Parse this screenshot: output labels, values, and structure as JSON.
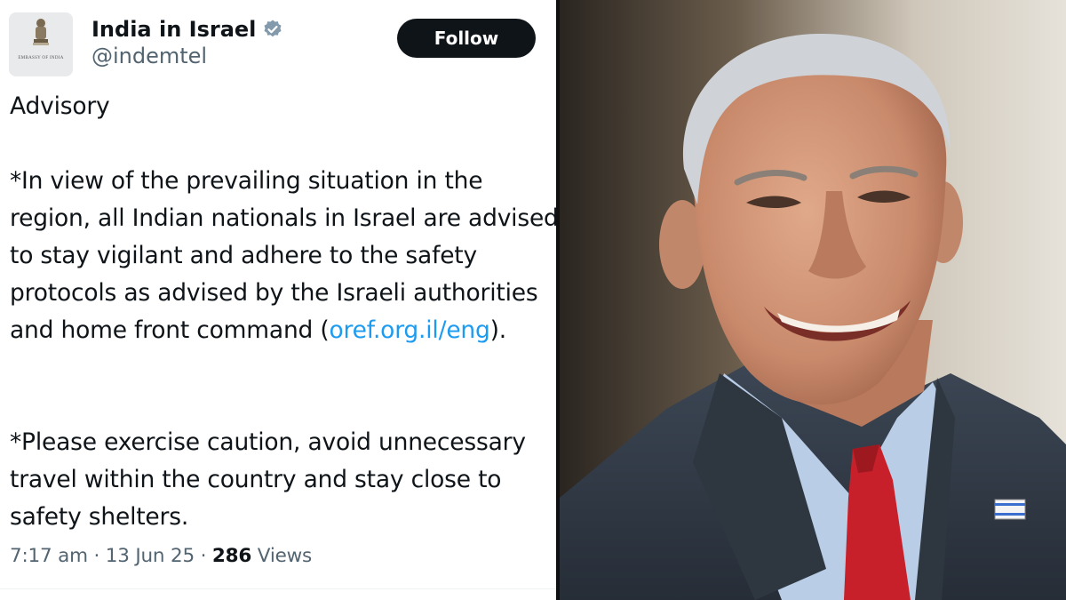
{
  "tweet": {
    "display_name": "India in Israel",
    "handle": "@indemtel",
    "follow_label": "Follow",
    "avatar_text": "EMBASSY OF INDIA",
    "heading": "Advisory",
    "para1_before": "*In view of the prevailing situation in the region, all Indian nationals in Israel are advised to stay vigilant and adhere to the safety protocols as advised by the Israeli authorities and home front command (",
    "para1_link": "oref.org.il/eng",
    "para1_after": ").",
    "para2": "*Please exercise caution, avoid unnecessary travel within the country and stay close to safety shelters.",
    "time": "7:17 am",
    "sep": "·",
    "date": "13 Jun 25",
    "views_count": "286",
    "views_label": "Views"
  },
  "colors": {
    "text": "#0f1419",
    "secondary": "#536471",
    "link": "#1d9bf0",
    "follow_bg": "#0f1419",
    "verified": "#829aab"
  },
  "photo": {
    "subject": "smiling man in dark suit and red tie"
  }
}
